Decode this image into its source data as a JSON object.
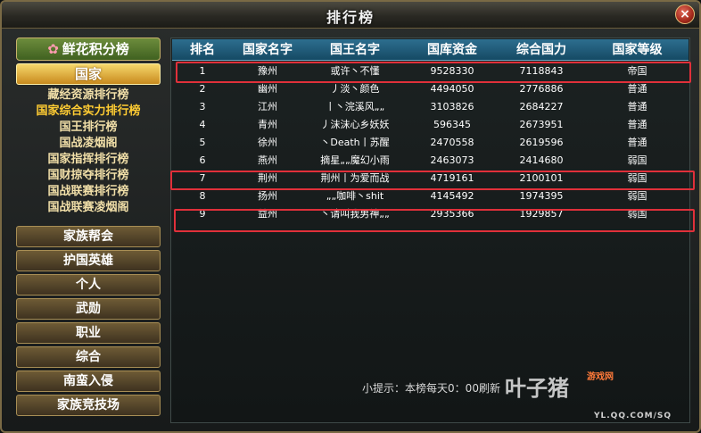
{
  "window": {
    "title": "排行榜",
    "close_icon": "×"
  },
  "sidebar": {
    "header": {
      "label": "鲜花积分榜",
      "icon": "flower-icon"
    },
    "active_category": "国家",
    "sub_items": [
      {
        "label": "藏经资源排行榜"
      },
      {
        "label": "国家综合实力排行榜"
      },
      {
        "label": "国王排行榜"
      },
      {
        "label": "国战凌烟阁"
      },
      {
        "label": "国家指挥排行榜"
      },
      {
        "label": "国财掠夺排行榜"
      },
      {
        "label": "国战联赛排行榜"
      },
      {
        "label": "国战联赛凌烟阁"
      }
    ],
    "nav_items": [
      {
        "label": "家族帮会"
      },
      {
        "label": "护国英雄"
      },
      {
        "label": "个人"
      },
      {
        "label": "武勋"
      },
      {
        "label": "职业"
      },
      {
        "label": "综合"
      },
      {
        "label": "南蛮入侵"
      },
      {
        "label": "家族竞技场"
      }
    ]
  },
  "table": {
    "headers": [
      "排名",
      "国家名字",
      "国王名字",
      "国库资金",
      "综合国力",
      "国家等级"
    ],
    "rows": [
      {
        "rank": "1",
        "country": "豫州",
        "king": "或许丶不懂",
        "treasury": "9528330",
        "power": "7118843",
        "level": "帝国"
      },
      {
        "rank": "2",
        "country": "幽州",
        "king": "丿淡丶颜色",
        "treasury": "4494050",
        "power": "2776886",
        "level": "普通"
      },
      {
        "rank": "3",
        "country": "江州",
        "king": "丨丶浣溪风„„",
        "treasury": "3103826",
        "power": "2684227",
        "level": "普通"
      },
      {
        "rank": "4",
        "country": "青州",
        "king": "丿沫沫心乡妖妖",
        "treasury": "596345",
        "power": "2673951",
        "level": "普通"
      },
      {
        "rank": "5",
        "country": "徐州",
        "king": "丶Death丨苏醒",
        "treasury": "2470558",
        "power": "2619596",
        "level": "普通"
      },
      {
        "rank": "6",
        "country": "燕州",
        "king": "摘星„„魔幻小雨",
        "treasury": "2463073",
        "power": "2414680",
        "level": "弱国"
      },
      {
        "rank": "7",
        "country": "荆州",
        "king": "荆州丨为爱而战",
        "treasury": "4719161",
        "power": "2100101",
        "level": "弱国"
      },
      {
        "rank": "8",
        "country": "扬州",
        "king": "„„咖啡丶shit",
        "treasury": "4145492",
        "power": "1974395",
        "level": "弱国"
      },
      {
        "rank": "9",
        "country": "益州",
        "king": "丶请叫我男神„„",
        "treasury": "2935366",
        "power": "1929857",
        "level": "弱国"
      }
    ]
  },
  "tip": "小提示：本榜每天0：00刷新",
  "watermark": {
    "left": "叶子猪",
    "brand": "游戏网",
    "site": "游戏网",
    "url": "YL.QQ.COM/SQ"
  },
  "colors": {
    "highlight_box": "#e0303a",
    "header_bg": "#2d6e8f",
    "active_tab": "#f6d76b"
  }
}
